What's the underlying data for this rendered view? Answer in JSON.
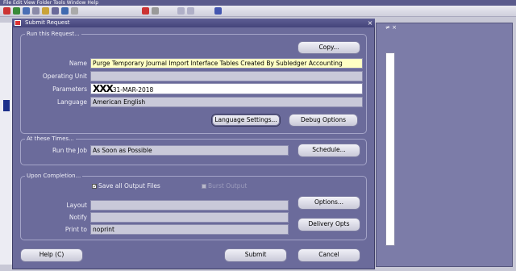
{
  "menubar": {
    "text": "File  Edit  View  Folder  Tools  Window  Help"
  },
  "background": {
    "right_title": "≠ ×"
  },
  "dialog": {
    "title": "Submit Request",
    "close_glyph": "×",
    "run_group": {
      "label": "Run this Request...",
      "copy_label": "Copy...",
      "fields": {
        "name_label": "Name",
        "name_value": "Purge Temporary Journal Import Interface Tables Created By Subledger Accounting",
        "operating_unit_label": "Operating Unit",
        "operating_unit_value": "",
        "parameters_label": "Parameters",
        "parameters_redaction": "XXX",
        "parameters_value": "31-MAR-2018",
        "language_label": "Language",
        "language_value": "American English"
      },
      "language_settings_label": "Language Settings...",
      "debug_options_label": "Debug Options"
    },
    "times_group": {
      "label": "At these Times...",
      "run_job_label": "Run the Job",
      "run_job_value": "As Soon as Possible",
      "schedule_label": "Schedule..."
    },
    "completion_group": {
      "label": "Upon Completion...",
      "save_output_label": "Save all Output Files",
      "save_output_checked": true,
      "burst_output_label": "Burst Output",
      "layout_label": "Layout",
      "layout_value": "",
      "notify_label": "Notify",
      "notify_value": "",
      "print_to_label": "Print to",
      "print_to_value": "noprint",
      "options_label": "Options...",
      "delivery_opts_label": "Delivery Opts"
    },
    "buttons": {
      "help_label": "Help (C)",
      "submit_label": "Submit",
      "cancel_label": "Cancel"
    }
  }
}
